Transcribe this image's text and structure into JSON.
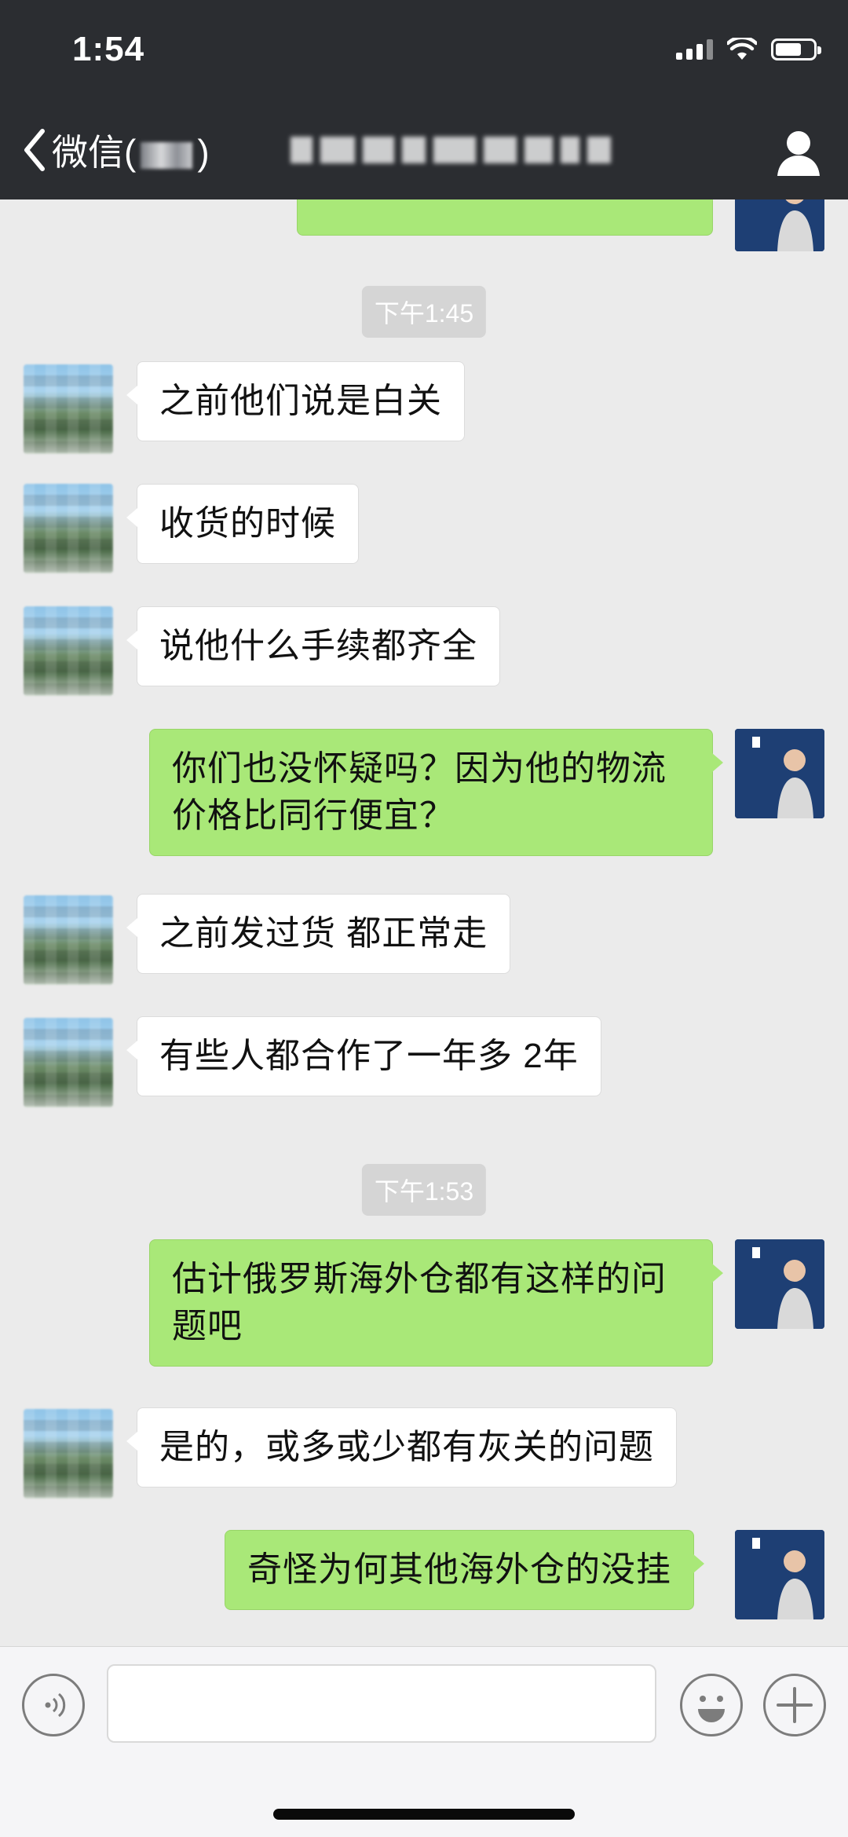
{
  "status_bar": {
    "time": "1:54"
  },
  "nav": {
    "back_label": "微信(",
    "back_label_end": ")",
    "title": ""
  },
  "messages": [
    {
      "type": "out",
      "text": ""
    },
    {
      "type": "time",
      "text": "下午1:45"
    },
    {
      "type": "in",
      "text": "之前他们说是白关"
    },
    {
      "type": "in",
      "text": "收货的时候"
    },
    {
      "type": "in",
      "text": "说他什么手续都齐全"
    },
    {
      "type": "out",
      "text": "你们也没怀疑吗？因为他的物流价格比同行便宜？"
    },
    {
      "type": "in",
      "text": "之前发过货 都正常走"
    },
    {
      "type": "in",
      "text": "有些人都合作了一年多 2年"
    },
    {
      "type": "time",
      "text": "下午1:53"
    },
    {
      "type": "out",
      "text": "估计俄罗斯海外仓都有这样的问题吧"
    },
    {
      "type": "in",
      "text": "是的，或多或少都有灰关的问题"
    },
    {
      "type": "out",
      "text": "奇怪为何其他海外仓的没挂"
    }
  ],
  "input": {
    "value": "",
    "placeholder": ""
  },
  "icons": {
    "back": "chevron-left-icon",
    "profile": "person-icon",
    "voice": "voice-icon",
    "emoji": "emoji-icon",
    "add": "plus-icon"
  },
  "colors": {
    "header_bg": "#2b2d31",
    "chat_bg": "#ebebeb",
    "bubble_out": "#a9e878",
    "bubble_in": "#ffffff"
  }
}
